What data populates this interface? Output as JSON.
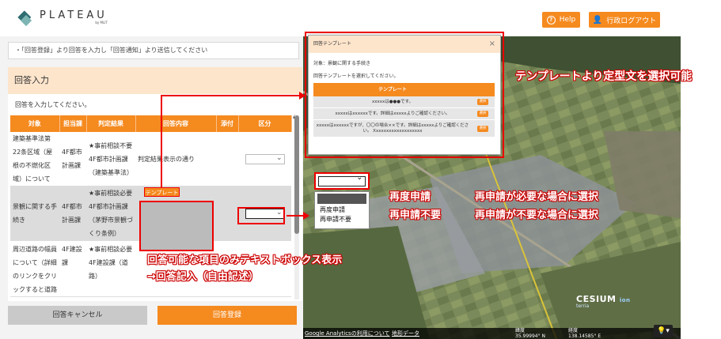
{
  "header": {
    "logo_text": "PLATEAU",
    "logo_sub": "by MLIT",
    "help_label": "Help",
    "logout_label": "行政ログアウト"
  },
  "left_panel": {
    "notice": "・「回答登録」より回答を入力し「回答通知」より送信してください",
    "section_title": "回答入力",
    "instruction": "回答を入力してください。",
    "table": {
      "headers": [
        "対象",
        "担当課",
        "判定結果",
        "回答内容",
        "添付",
        "区分"
      ],
      "rows": [
        {
          "target": "建築基準法第22条区域（屋根の不燃化区域）について",
          "dept": "4F都市計画課",
          "result": "★事前相談不要 4F都市計画課（建築基準法）",
          "answer": "判定結果表示の通り"
        },
        {
          "target": "景観に関する手続き",
          "dept": "4F都市計画課",
          "result": "★事前相談必要 4F都市計画課（茅野市景観づくり条例）",
          "answer": ""
        },
        {
          "target": "周辺道路の幅員について（詳細のリンクをクリックすると道路",
          "dept": "4F建設課",
          "result": "★事前相談必要 4F建設課（道路）",
          "answer": ""
        }
      ],
      "template_button": "テンプレート"
    },
    "cancel_button": "回答キャンセル",
    "register_button": "回答登録"
  },
  "dialog": {
    "title": "回答テンプレート",
    "close_icon": "close-icon",
    "target": "対象：景観に関する手続き",
    "instruction": "回答テンプレートを選択してください。",
    "table_header": "テンプレート",
    "rows": [
      {
        "text": "xxxxxは●●●です。",
        "select_label": "選択"
      },
      {
        "text": "xxxxxはxxxxxxです。詳細はxxxxxよりご確認ください。",
        "select_label": "選択"
      },
      {
        "text": "xxxxxはxxxxxxですが、〇〇の場合××です。詳細はxxxxxよりご確認ください。 Xxxxxxxxxxxxxxxxxxx",
        "select_label": "選択"
      }
    ]
  },
  "dropdown_demo": {
    "options": [
      "再度申請",
      "再申請不要"
    ]
  },
  "annotations": {
    "template_note": "テンプレートより定型文を選択可能",
    "reapply_label": "再度申請",
    "no_reapply_label": "再申請不要",
    "reapply_desc": "再申請が必要な場合に選択",
    "no_reapply_desc": "再申請が不要な場合に選択",
    "textbox_note_1": "回答可能な項目のみテキストボックス表示",
    "textbox_note_2": "→回答記入（自由記述）"
  },
  "map": {
    "footer_link_1": "Google Analyticsの利用について",
    "footer_link_2": "地形データ",
    "lat_label": "緯度",
    "lat_value": "35.99994° N",
    "lon_label": "経度",
    "lon_value": "138.14585° E",
    "brand_cesium": "CESIUM",
    "brand_ion": "ion",
    "brand_terria": "terria",
    "bulb_icon": "lightbulb-icon"
  },
  "colors": {
    "accent": "#f58a1f",
    "section_bg": "#fde5cc",
    "annotation_red": "#e00000"
  }
}
